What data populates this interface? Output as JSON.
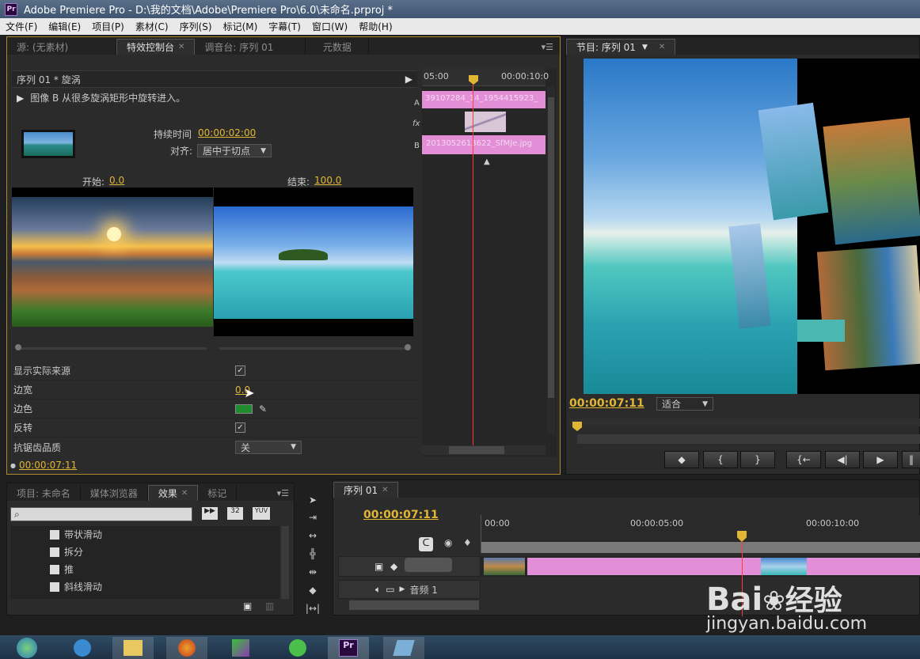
{
  "title": "Adobe Premiere Pro - D:\\我的文档\\Adobe\\Premiere Pro\\6.0\\未命名.prproj *",
  "app_badge": "Pr",
  "menu": [
    "文件(F)",
    "编辑(E)",
    "项目(P)",
    "素材(C)",
    "序列(S)",
    "标记(M)",
    "字幕(T)",
    "窗口(W)",
    "帮助(H)"
  ],
  "effect_panel": {
    "tabs": [
      "源: (无素材)",
      "特效控制台",
      "调音台: 序列 01",
      "元数据"
    ],
    "header": "序列 01 * 旋涡",
    "description": "图像 B 从很多旋涡矩形中旋转进入。",
    "duration_label": "持续时间",
    "duration_value": "00:00:02:00",
    "align_label": "对齐:",
    "align_value": "居中于切点",
    "start_label": "开始:",
    "start_value": "0.0",
    "end_label": "结束:",
    "end_value": "100.0",
    "props": [
      {
        "label": "显示实际来源",
        "type": "checkbox",
        "checked": true
      },
      {
        "label": "边宽",
        "type": "value",
        "value": "0.0"
      },
      {
        "label": "边色",
        "type": "color",
        "color": "#1f8a2e"
      },
      {
        "label": "反转",
        "type": "checkbox",
        "checked": true
      },
      {
        "label": "抗锯齿品质",
        "type": "dropdown",
        "value": "关"
      }
    ],
    "current_time": "00:00:07:11",
    "mini_timeline": {
      "ruler_start": "05:00",
      "ruler_end": "00:00:10:0",
      "track_a_label": "A",
      "track_fx_label": "fx",
      "track_b_label": "B",
      "clip_a": "39107284_14_1954415923_",
      "clip_b": "2013052613622_SfMJe.jpg"
    }
  },
  "program_monitor": {
    "tab": "节目: 序列 01",
    "timecode": "00:00:07:11",
    "fit": "适合",
    "controls": [
      "◆",
      "{",
      "}",
      "{←",
      "◀|",
      "▶",
      "‖"
    ]
  },
  "project_panel": {
    "tabs": [
      "项目: 未命名",
      "媒体浏览器",
      "效果",
      "标记"
    ],
    "badges": [
      "32",
      "YUV"
    ],
    "items": [
      "带状滑动",
      "拆分",
      "推",
      "斜线滑动"
    ]
  },
  "timeline": {
    "tab": "序列 01",
    "timecode": "00:00:07:11",
    "ruler": [
      "00:00",
      "00:00:05:00",
      "00:00:10:00"
    ],
    "audio_track": "音频 1"
  },
  "watermark": {
    "brand": "Bai",
    "brand_cn": "经验",
    "url": "jingyan.baidu.com"
  },
  "colors": {
    "accent": "#e2b635",
    "clip": "#e38fd8",
    "playhead": "#ff3b3b"
  }
}
